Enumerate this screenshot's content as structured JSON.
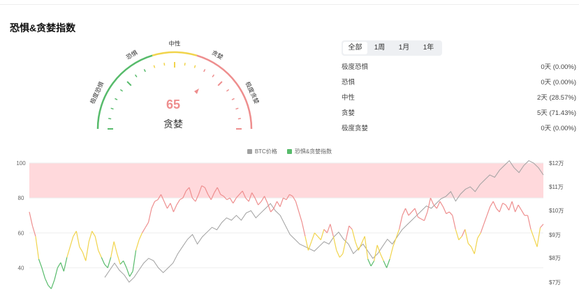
{
  "title": "恐惧&贪婪指数",
  "gauge": {
    "value": "65",
    "label": "贪婪",
    "labels": [
      "极度恐惧",
      "恐惧",
      "中性",
      "贪婪",
      "极度贪婪"
    ],
    "colors": {
      "fear": "#57bb6b",
      "neutral": "#f1d44c",
      "greed": "#ee8e8e"
    }
  },
  "tabs": [
    {
      "label": "全部",
      "active": true
    },
    {
      "label": "1周",
      "active": false
    },
    {
      "label": "1月",
      "active": false
    },
    {
      "label": "1年",
      "active": false
    }
  ],
  "stats": [
    {
      "name": "极度恐惧",
      "value": "0天 (0.00%)"
    },
    {
      "name": "恐惧",
      "value": "0天 (0.00%)"
    },
    {
      "name": "中性",
      "value": "2天 (28.57%)"
    },
    {
      "name": "贪婪",
      "value": "5天 (71.43%)"
    },
    {
      "name": "极度贪婪",
      "value": "0天 (0.00%)"
    }
  ],
  "chart_data": {
    "type": "line",
    "legend": [
      {
        "name": "BTC价格",
        "color": "#a0a0a0"
      },
      {
        "name": "恐惧&贪婪指数",
        "color": "#57bb6b"
      }
    ],
    "left_axis": {
      "ticks": [
        "100",
        "80",
        "60",
        "40"
      ],
      "ylim": [
        25,
        100
      ]
    },
    "right_axis": {
      "ticks": [
        "$12万",
        "$11万",
        "$10万",
        "$9万",
        "$8万",
        "$7万"
      ]
    },
    "extreme_greed_band": [
      80,
      100
    ],
    "fear_greed_index": [
      72,
      64,
      58,
      45,
      40,
      34,
      30,
      28,
      33,
      40,
      43,
      38,
      46,
      52,
      58,
      61,
      52,
      49,
      44,
      55,
      61,
      58,
      50,
      46,
      42,
      40,
      46,
      55,
      48,
      42,
      44,
      40,
      35,
      38,
      50,
      56,
      60,
      63,
      66,
      74,
      78,
      79,
      82,
      78,
      74,
      77,
      72,
      76,
      79,
      80,
      84,
      86,
      80,
      78,
      82,
      87,
      86,
      82,
      79,
      83,
      86,
      82,
      81,
      79,
      80,
      77,
      80,
      82,
      84,
      80,
      78,
      83,
      80,
      76,
      78,
      81,
      77,
      72,
      74,
      78,
      75,
      80,
      79,
      82,
      81,
      78,
      72,
      66,
      58,
      50,
      55,
      60,
      58,
      56,
      62,
      60,
      65,
      58,
      50,
      46,
      48,
      56,
      64,
      62,
      55,
      50,
      54,
      58,
      45,
      41,
      44,
      53,
      48,
      44,
      40,
      45,
      52,
      57,
      62,
      70,
      74,
      70,
      72,
      74,
      69,
      68,
      67,
      72,
      80,
      76,
      74,
      78,
      75,
      71,
      72,
      70,
      62,
      56,
      58,
      62,
      54,
      52,
      48,
      57,
      60,
      65,
      70,
      75,
      78,
      74,
      72,
      77,
      76,
      73,
      78,
      72,
      76,
      73,
      70,
      70,
      62,
      57,
      52,
      63,
      65
    ],
    "btc_price_wan": [
      7.2,
      7.5,
      7.8,
      7.5,
      7.3,
      7.0,
      7.2,
      7.5,
      7.8,
      8.0,
      7.9,
      7.6,
      7.4,
      7.6,
      7.8,
      8.2,
      8.5,
      8.8,
      9.0,
      8.6,
      8.9,
      9.1,
      9.3,
      9.2,
      9.5,
      9.7,
      9.6,
      9.8,
      9.6,
      9.9,
      10.0,
      9.7,
      9.9,
      10.1,
      10.3,
      10.0,
      9.8,
      9.4,
      9.0,
      8.8,
      8.6,
      8.5,
      8.4,
      8.3,
      8.5,
      8.7,
      8.6,
      8.9,
      9.1,
      8.8,
      8.6,
      8.2,
      8.4,
      8.6,
      8.3,
      8.0,
      8.2,
      8.5,
      8.8,
      8.6,
      8.9,
      9.2,
      9.4,
      9.6,
      9.8,
      10.0,
      10.2,
      10.1,
      10.3,
      10.5,
      10.6,
      10.8,
      10.4,
      10.7,
      10.9,
      11.0,
      10.8,
      11.1,
      11.3,
      11.5,
      11.4,
      11.7,
      11.9,
      12.1,
      11.8,
      11.6,
      11.9,
      12.1,
      12.0,
      11.8,
      11.5
    ],
    "btc_scale": {
      "wan_min": 7,
      "wan_max": 12
    }
  }
}
